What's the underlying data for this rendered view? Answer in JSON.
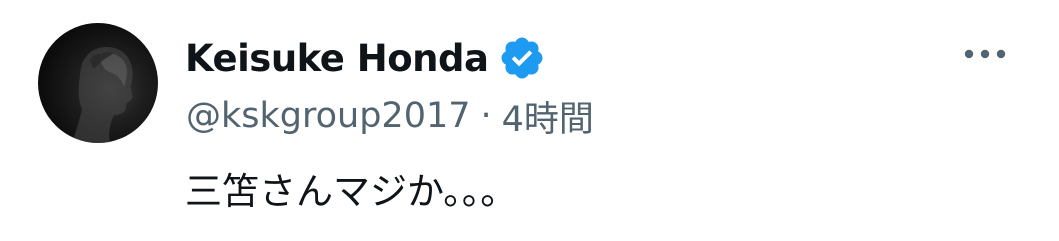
{
  "tweet": {
    "author": {
      "display_name": "Keisuke Honda",
      "handle": "@ksk­group2017",
      "avatar": "avatar-photo",
      "verified_icon": "verified-badge-icon"
    },
    "separator": "·",
    "timestamp": "4時間",
    "text": "三笘さんマジか。。。",
    "more_icon": "more-horizontal-icon"
  },
  "colors": {
    "text_primary": "#0f1419",
    "text_secondary": "#536471",
    "verified_blue": "#1d9bf0",
    "background": "#ffffff"
  }
}
